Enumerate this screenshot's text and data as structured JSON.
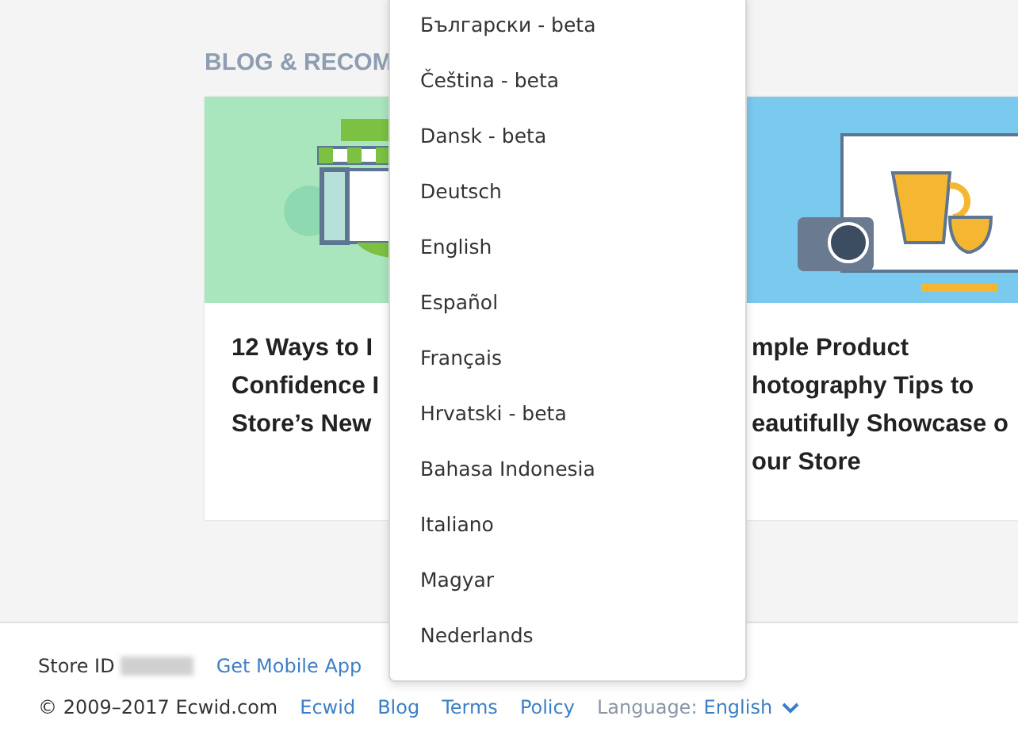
{
  "section": {
    "heading": "BLOG & RECOM"
  },
  "cards": [
    {
      "kind": "store",
      "title_lines": [
        "12 Ways to I",
        "Confidence I",
        "Store’s New"
      ]
    },
    {
      "kind": "camera",
      "title_lines": [
        "mple Product",
        "hotography Tips to",
        "eautifully Showcase o",
        "our Store"
      ]
    }
  ],
  "footer": {
    "store_id_label": "Store ID",
    "mobile_link": "Get Mobile App",
    "copyright": "© 2009–2017 Ecwid.com",
    "links": [
      "Ecwid",
      "Blog",
      "Terms",
      "Policy"
    ],
    "language_label": "Language:",
    "language_value": "English"
  },
  "language_menu": {
    "items": [
      "Български - beta",
      "Čeština - beta",
      "Dansk - beta",
      "Deutsch",
      "English",
      "Español",
      "Français",
      "Hrvatski - beta",
      "Bahasa Indonesia",
      "Italiano",
      "Magyar",
      "Nederlands"
    ]
  }
}
